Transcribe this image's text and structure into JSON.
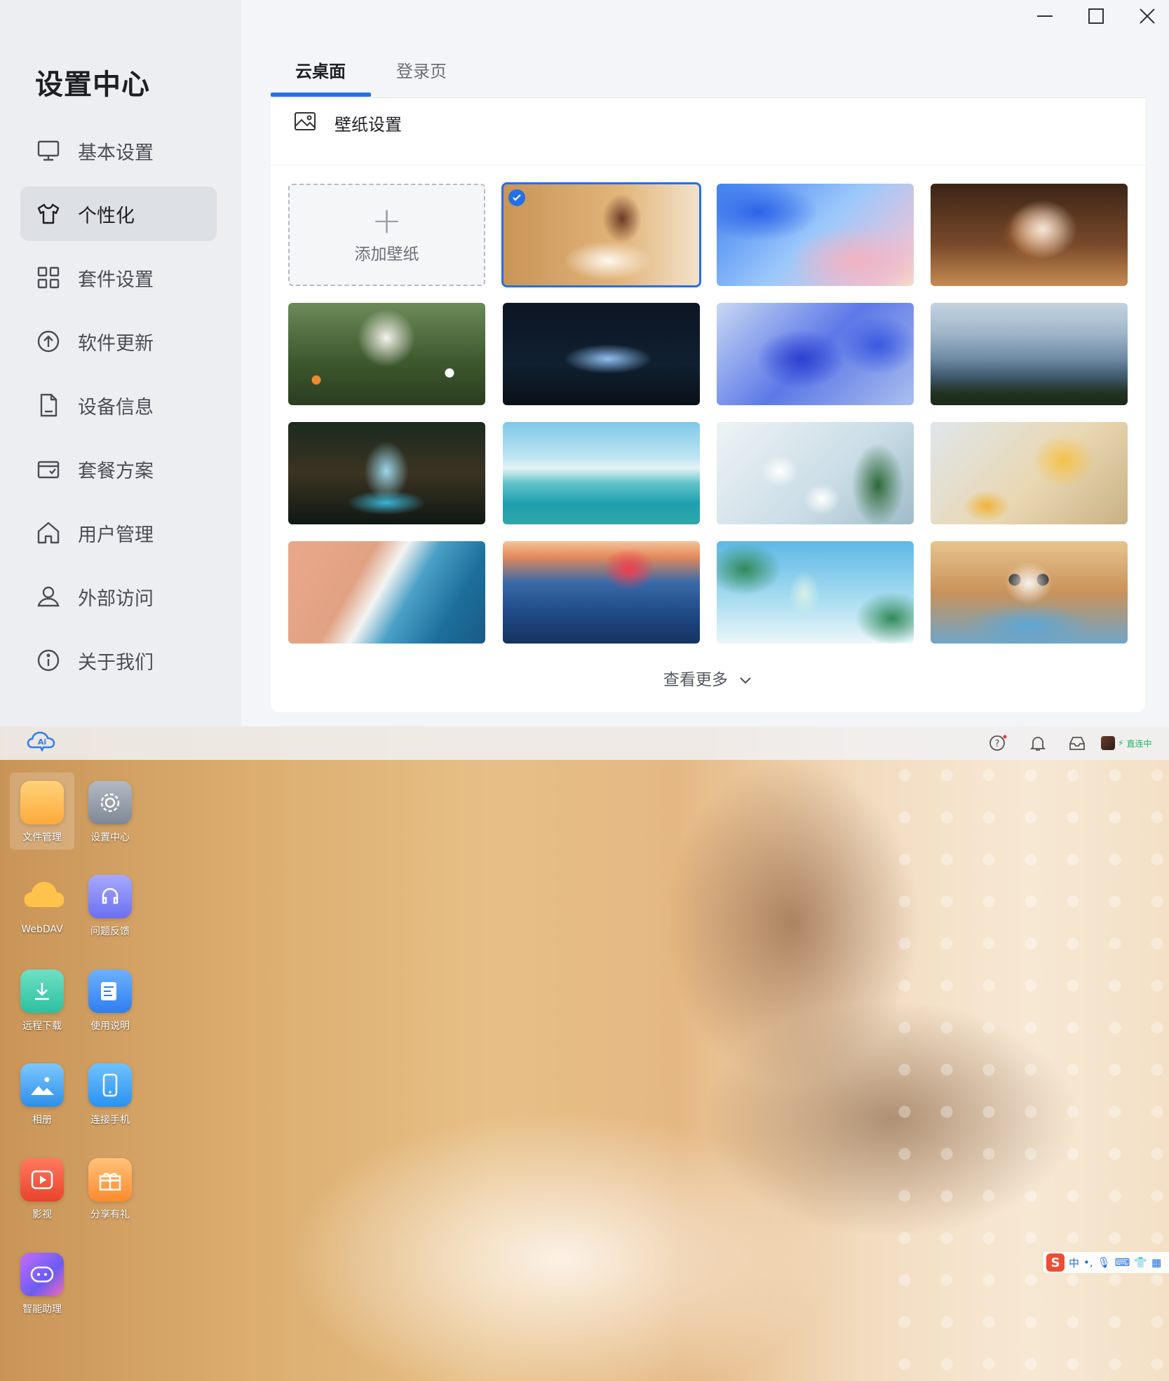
{
  "settings": {
    "title": "设置中心",
    "nav": [
      {
        "label": "基本设置",
        "icon": "monitor-icon",
        "active": false
      },
      {
        "label": "个性化",
        "icon": "shirt-icon",
        "active": true
      },
      {
        "label": "套件设置",
        "icon": "grid-icon",
        "active": false
      },
      {
        "label": "软件更新",
        "icon": "upload-circle-icon",
        "active": false
      },
      {
        "label": "设备信息",
        "icon": "document-icon",
        "active": false
      },
      {
        "label": "套餐方案",
        "icon": "package-icon",
        "active": false
      },
      {
        "label": "用户管理",
        "icon": "home-icon",
        "active": false
      },
      {
        "label": "外部访问",
        "icon": "user-icon",
        "active": false
      },
      {
        "label": "关于我们",
        "icon": "info-icon",
        "active": false
      }
    ],
    "window_controls": [
      "minimize-icon",
      "maximize-icon",
      "close-icon"
    ],
    "tabs": [
      {
        "label": "云桌面",
        "active": true
      },
      {
        "label": "登录页",
        "active": false
      }
    ],
    "section_title": "壁纸设置",
    "add_wallpaper_label": "添加壁纸",
    "add_plus": "+",
    "wallpapers": [
      {
        "name": "girl-reading",
        "selected": true
      },
      {
        "name": "blue-abstract-wave",
        "selected": false
      },
      {
        "name": "fluffy-cat",
        "selected": false
      },
      {
        "name": "white-puppy-flowers",
        "selected": false
      },
      {
        "name": "blue-lily-dark",
        "selected": false
      },
      {
        "name": "blue-lily-bright",
        "selected": false
      },
      {
        "name": "misty-mountains",
        "selected": false
      },
      {
        "name": "forest-waterfall",
        "selected": false
      },
      {
        "name": "turquoise-waves",
        "selected": false
      },
      {
        "name": "white-lilies",
        "selected": false
      },
      {
        "name": "yellow-dahlias",
        "selected": false
      },
      {
        "name": "beach-aerial",
        "selected": false
      },
      {
        "name": "ocean-wave-sunset",
        "selected": false
      },
      {
        "name": "mojito-tropical",
        "selected": false
      },
      {
        "name": "panda-splash",
        "selected": false
      }
    ],
    "see_more_label": "查看更多"
  },
  "desktop": {
    "taskbar": {
      "logo_text": "Ai",
      "icons": [
        "help-icon",
        "bell-icon",
        "inbox-icon"
      ],
      "status_text": "直连中"
    },
    "apps": [
      {
        "label": "文件管理",
        "icon": "folder-icon",
        "color": "#ffb648"
      },
      {
        "label": "设置中心",
        "icon": "gear-icon",
        "color": "#8d95a3"
      },
      {
        "label": "WebDAV",
        "icon": "cloud-icon",
        "color": "#ffc24a"
      },
      {
        "label": "问题反馈",
        "icon": "headset-icon",
        "color": "#7b7ff0"
      },
      {
        "label": "远程下载",
        "icon": "download-icon",
        "color": "#36c9a8"
      },
      {
        "label": "使用说明",
        "icon": "manual-icon",
        "color": "#3b8df2"
      },
      {
        "label": "相册",
        "icon": "photo-icon",
        "color": "#4aa9f2"
      },
      {
        "label": "连接手机",
        "icon": "phone-icon",
        "color": "#3aa6f5"
      },
      {
        "label": "影视",
        "icon": "play-icon",
        "color": "#f2543c"
      },
      {
        "label": "分享有礼",
        "icon": "gift-icon",
        "color": "#ff9a3a"
      },
      {
        "label": "智能助理",
        "icon": "chat-icon",
        "color": "#9b5cf2"
      }
    ],
    "ime": {
      "logo": "S",
      "mode": "中"
    }
  }
}
